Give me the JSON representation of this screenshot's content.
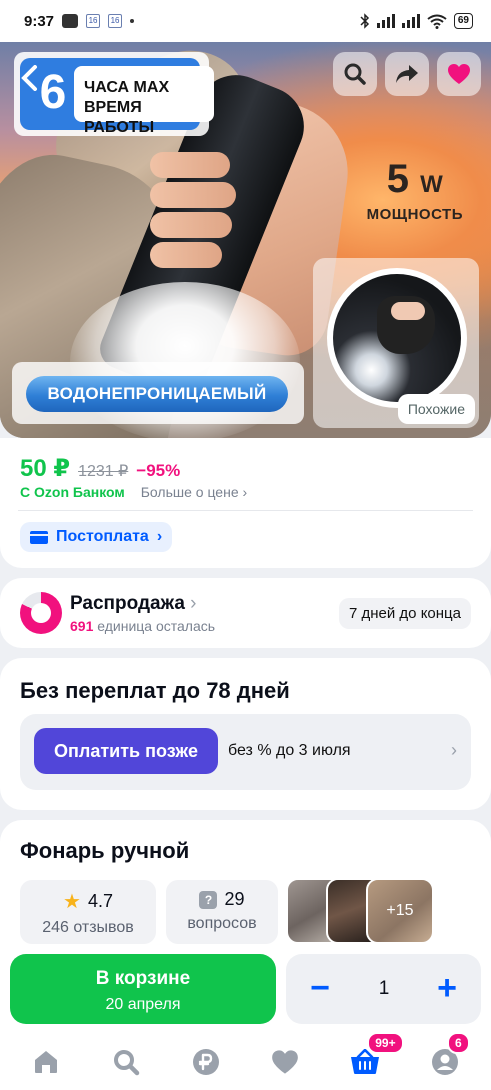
{
  "status_bar": {
    "time": "9:37",
    "calendar_1": "16",
    "calendar_2": "16",
    "battery": "69"
  },
  "hero": {
    "hours_number": "6",
    "hours_text_line1": "ЧАСА MAX",
    "hours_text_line2": "ВРЕМЯ РАБОТЫ",
    "power_value": "5",
    "power_unit": "W",
    "power_label": "МОЩНОСТЬ",
    "waterproof": "ВОДОНЕПРОНИЦАЕМЫЙ",
    "similar_label": "Похожие",
    "actions": [
      "search-icon",
      "share-icon",
      "heart-icon"
    ],
    "favorite_color": "#f1117e"
  },
  "price": {
    "current": "50 ₽",
    "old": "1231 ₽",
    "discount": "−95%",
    "bank": "С Ozon Банком",
    "more": "Больше о цене",
    "postpay": "Постоплата",
    "green": "#10c44c"
  },
  "sale": {
    "title": "Распродажа",
    "count": "691",
    "count_text": "единица осталась",
    "days_left": "7 дней до конца"
  },
  "pay_later": {
    "title": "Без переплат до 78 дней",
    "button": "Оплатить позже",
    "description": "без % до 3 июля",
    "button_color": "#5146d9"
  },
  "product": {
    "title": "Фонарь ручной",
    "rating": "4.7",
    "reviews": "246 отзывов",
    "questions_count": "29",
    "questions_label": "вопросов",
    "more_photos": "+15"
  },
  "action_bar": {
    "cart_title": "В корзине",
    "cart_date": "20 апреля",
    "quantity": "1",
    "minus": "−",
    "plus": "+"
  },
  "tabbar": {
    "items": [
      "home-icon",
      "search-icon",
      "ruble-icon",
      "heart-icon",
      "cart-icon",
      "profile-icon"
    ],
    "cart_badge": "99+",
    "profile_badge": "6",
    "accent": "#005bff"
  }
}
